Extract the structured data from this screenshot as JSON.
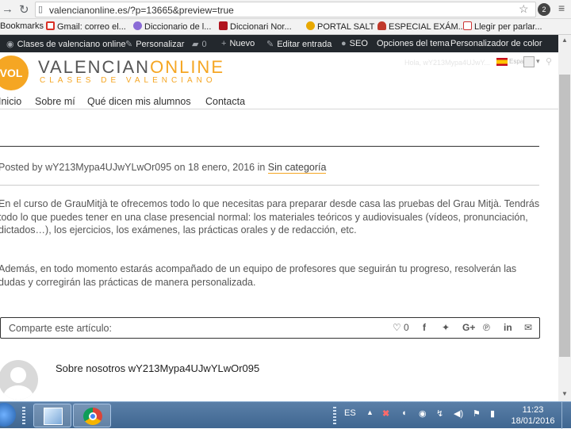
{
  "browser": {
    "url": "valencianonline.es/?p=13665&preview=true",
    "ext_badge": "2"
  },
  "bookmarks": [
    {
      "label": "Bookmarks",
      "color": ""
    },
    {
      "label": "Gmail: correo el...",
      "color": "#d93025"
    },
    {
      "label": "Diccionario de l...",
      "color": "#8a6bd6"
    },
    {
      "label": "Diccionari Nor...",
      "color": "#b0141f"
    },
    {
      "label": "PORTAL SALT",
      "color": "#e8a800"
    },
    {
      "label": "ESPECIAL EXÁM...",
      "color": "#c0392b"
    },
    {
      "label": "Llegir per parlar...",
      "color": "#cc3333"
    }
  ],
  "wpbar": {
    "site": "Clases de valenciano online",
    "customize": "Personalizar",
    "comments": "0",
    "new": "Nuevo",
    "edit": "Editar entrada",
    "seo": "SEO",
    "theme_options": "Opciones del tema",
    "color_customizer": "Personalizador de color"
  },
  "logo": {
    "mark": "VOL",
    "name_a": "VALENCIAN",
    "name_b": "ONLINE",
    "tagline": "CLASES DE VALENCIANO"
  },
  "user": {
    "greeting": "Hola, wY213Mypa4UJwY...",
    "lang": "Españ"
  },
  "nav": [
    "Inicio",
    "Sobre mí",
    "Qué dicen mis alumnos",
    "Contacta"
  ],
  "post": {
    "meta_prefix": "Posted by wY213Mypa4UJwYLwOr095 on 18 enero, 2016 in ",
    "category": "Sin categoría",
    "paragraph1": "En el curso de GrauMitjà te ofrecemos todo lo que necesitas para preparar desde casa las pruebas del Grau Mitjà. Tendrás todo lo que puedes tener en una clase presencial normal: los materiales teóricos y audiovisuales (vídeos, pronunciación, dictados…), los ejercicios, los exámenes, las prácticas orales y de redacción, etc.",
    "paragraph2": "Además, en todo momento estarás acompañado de un equipo de profesores que seguirán tu progreso, resolverán las dudas y corregirán las prácticas de manera personalizada."
  },
  "share": {
    "label": "Comparte este artículo:",
    "likes": "0",
    "icons": [
      "heart-icon",
      "facebook-icon",
      "twitter-icon",
      "googleplus-icon",
      "pinterest-icon",
      "linkedin-icon",
      "email-icon"
    ]
  },
  "author": {
    "title": "Sobre nosotros wY213Mypa4UJwYLwOr095"
  },
  "taskbar": {
    "lang": "ES",
    "time": "11:23",
    "date": "18/01/2016"
  },
  "colors": {
    "accent": "#f5a623",
    "adminbar": "#23282d"
  }
}
